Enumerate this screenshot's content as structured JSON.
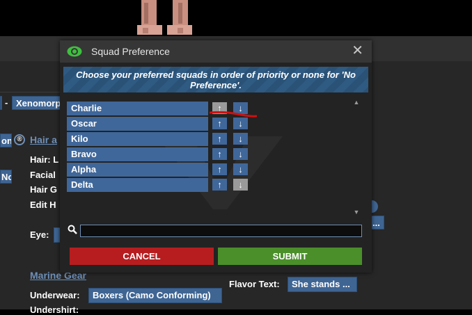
{
  "background": {
    "xeno_button": "Xenomorp",
    "dash": "-",
    "left_button_1": "on",
    "circle_r": "®",
    "hair_link": "Hair a",
    "left_button_2": "No",
    "hair_label": "Hair: L",
    "facial_label": "Facial",
    "hair_g_label": "Hair G",
    "edit_h_label": "Edit H",
    "eye_label": "Eye:",
    "right_button_fragment": "...",
    "marine_gear_link": "Marine Gear",
    "underwear_label": "Underwear:",
    "underwear_value": "Boxers (Camo Conforming)",
    "undershirt_label": "Undershirt:",
    "flavor_text_label": "Flavor Text:",
    "flavor_text_value": "She stands ..."
  },
  "modal": {
    "title": "Squad Preference",
    "close_symbol": "✕",
    "instructions": "Choose your preferred squads in order of priority or none for 'No Preference'.",
    "squads": [
      {
        "name": "Charlie",
        "up_enabled": false,
        "down_enabled": true
      },
      {
        "name": "Oscar",
        "up_enabled": true,
        "down_enabled": true
      },
      {
        "name": "Kilo",
        "up_enabled": true,
        "down_enabled": true
      },
      {
        "name": "Bravo",
        "up_enabled": true,
        "down_enabled": true
      },
      {
        "name": "Alpha",
        "up_enabled": true,
        "down_enabled": true
      },
      {
        "name": "Delta",
        "up_enabled": true,
        "down_enabled": false
      }
    ],
    "up_symbol": "↑",
    "down_symbol": "↓",
    "search": {
      "value": "",
      "placeholder": ""
    },
    "cancel_label": "CANCEL",
    "submit_label": "SUBMIT",
    "colors": {
      "squad_blue": "#40679a",
      "disabled_gray": "#9a9a9a",
      "cancel_red": "#b71d1f",
      "submit_green": "#4a8f2a",
      "annotation_red": "#d01010"
    }
  }
}
